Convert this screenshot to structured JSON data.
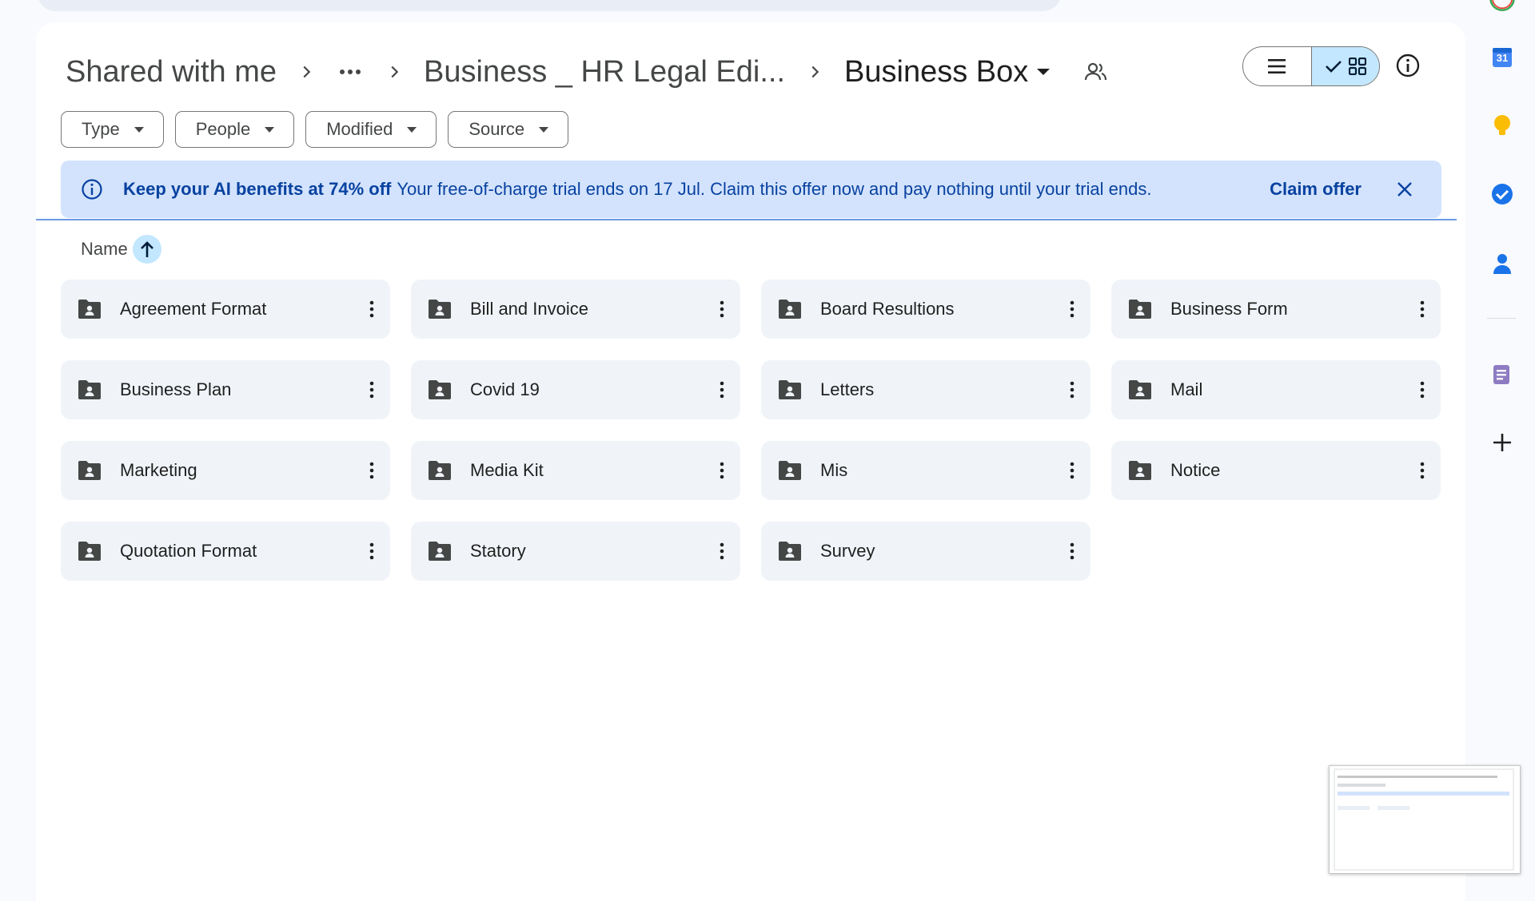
{
  "breadcrumb": {
    "root": "Shared with me",
    "middle": "Business _ HR Legal Edi...",
    "current": "Business Box"
  },
  "view": {
    "mode": "grid"
  },
  "filters": [
    {
      "label": "Type"
    },
    {
      "label": "People"
    },
    {
      "label": "Modified"
    },
    {
      "label": "Source"
    }
  ],
  "banner": {
    "title": "Keep your AI benefits at 74% off",
    "message": "Your free-of-charge trial ends on 17 Jul. Claim this offer now and pay nothing until your trial ends.",
    "action": "Claim offer"
  },
  "sort": {
    "label": "Name",
    "direction": "ascending"
  },
  "folders": [
    {
      "name": "Agreement Format"
    },
    {
      "name": "Bill and Invoice"
    },
    {
      "name": "Board Resultions"
    },
    {
      "name": "Business Form"
    },
    {
      "name": "Business Plan"
    },
    {
      "name": "Covid 19"
    },
    {
      "name": "Letters"
    },
    {
      "name": "Mail"
    },
    {
      "name": "Marketing"
    },
    {
      "name": "Media Kit"
    },
    {
      "name": "Mis"
    },
    {
      "name": "Notice"
    },
    {
      "name": "Quotation Format"
    },
    {
      "name": "Statory"
    },
    {
      "name": "Survey"
    }
  ],
  "side_panel": {
    "calendar_day": "31",
    "apps": [
      "calendar-icon",
      "keep-icon",
      "tasks-icon",
      "contacts-icon",
      "addon-icon",
      "add-icon"
    ]
  },
  "colors": {
    "accent": "#0b57d0",
    "banner_bg": "#d3e3fd",
    "banner_text": "#0842a0",
    "selected_toggle": "#c2e7ff",
    "folder_bg": "#f0f4f9"
  }
}
